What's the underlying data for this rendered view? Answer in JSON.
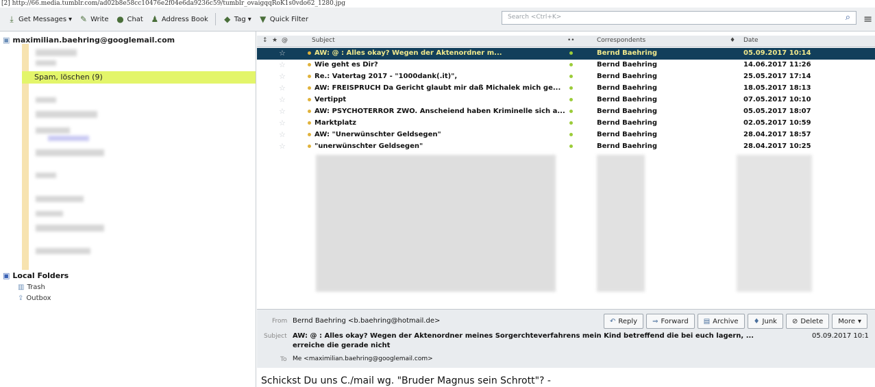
{
  "url": "[2] http://66.media.tumblr.com/ad02b8e58cc10476e2f04e6da9236c59/tumblr_ovaigqqRoK1s0vdo62_1280.jpg",
  "toolbar": {
    "get_messages": "Get Messages",
    "write": "Write",
    "chat": "Chat",
    "address_book": "Address Book",
    "tag": "Tag",
    "quick_filter": "Quick Filter",
    "search_placeholder": "Search <Ctrl+K>"
  },
  "folders": {
    "account": "maximilian.baehring@googlemail.com",
    "spam": "Spam, löschen (9)",
    "local_folders": "Local Folders",
    "trash": "Trash",
    "outbox": "Outbox"
  },
  "columns": {
    "subject": "Subject",
    "correspondents": "Correspondents",
    "date": "Date"
  },
  "messages": [
    {
      "subject": "AW: @                    : Alles okay? Wegen der Aktenordner m...",
      "from": "Bernd Baehring",
      "date": "05.09.2017 10:14"
    },
    {
      "subject": "Wie geht es Dir?",
      "from": "Bernd Baehring",
      "date": "14.06.2017 11:26"
    },
    {
      "subject": "Re.: Vatertag 2017 - \"1000dank(.it)\",",
      "from": "Bernd Baehring",
      "date": "25.05.2017 17:14"
    },
    {
      "subject": "AW: FREISPRUCH Da Gericht glaubt mir daß Michalek mich ge...",
      "from": "Bernd Baehring",
      "date": "18.05.2017 18:13"
    },
    {
      "subject": "Vertippt",
      "from": "Bernd Baehring",
      "date": "07.05.2017 10:10"
    },
    {
      "subject": "AW: PSYCHOTERROR ZWO. Anscheiend haben Kriminelle sich a...",
      "from": "Bernd Baehring",
      "date": "05.05.2017 18:07"
    },
    {
      "subject": "Marktplatz",
      "from": "Bernd Baehring",
      "date": "02.05.2017 10:59"
    },
    {
      "subject": "AW: \"Unerwünschter Geldsegen\"",
      "from": "Bernd Baehring",
      "date": "28.04.2017 18:57"
    },
    {
      "subject": "\"unerwünschter Geldsegen\"",
      "from": "Bernd Baehring",
      "date": "28.04.2017 10:25"
    }
  ],
  "preview": {
    "from_label": "From",
    "from": "Bernd Baehring <b.baehring@hotmail.de>",
    "subject_label": "Subject",
    "subject_line1": "AW: @              : Alles okay? Wegen der Aktenordner meines Sorgerchteverfahrens mein Kind betreffend die bei euch lagern, ...",
    "subject_line2": "erreiche die          gerade nicht",
    "date": "05.09.2017 10:1",
    "to_label": "To",
    "to": "Me <maximilian.baehring@googlemail.com>",
    "buttons": {
      "reply": "Reply",
      "forward": "Forward",
      "archive": "Archive",
      "junk": "Junk",
      "delete": "Delete",
      "more": "More"
    },
    "body": "Schickst Du uns C./mail wg. \"Bruder Magnus sein Schrott\"? -"
  }
}
